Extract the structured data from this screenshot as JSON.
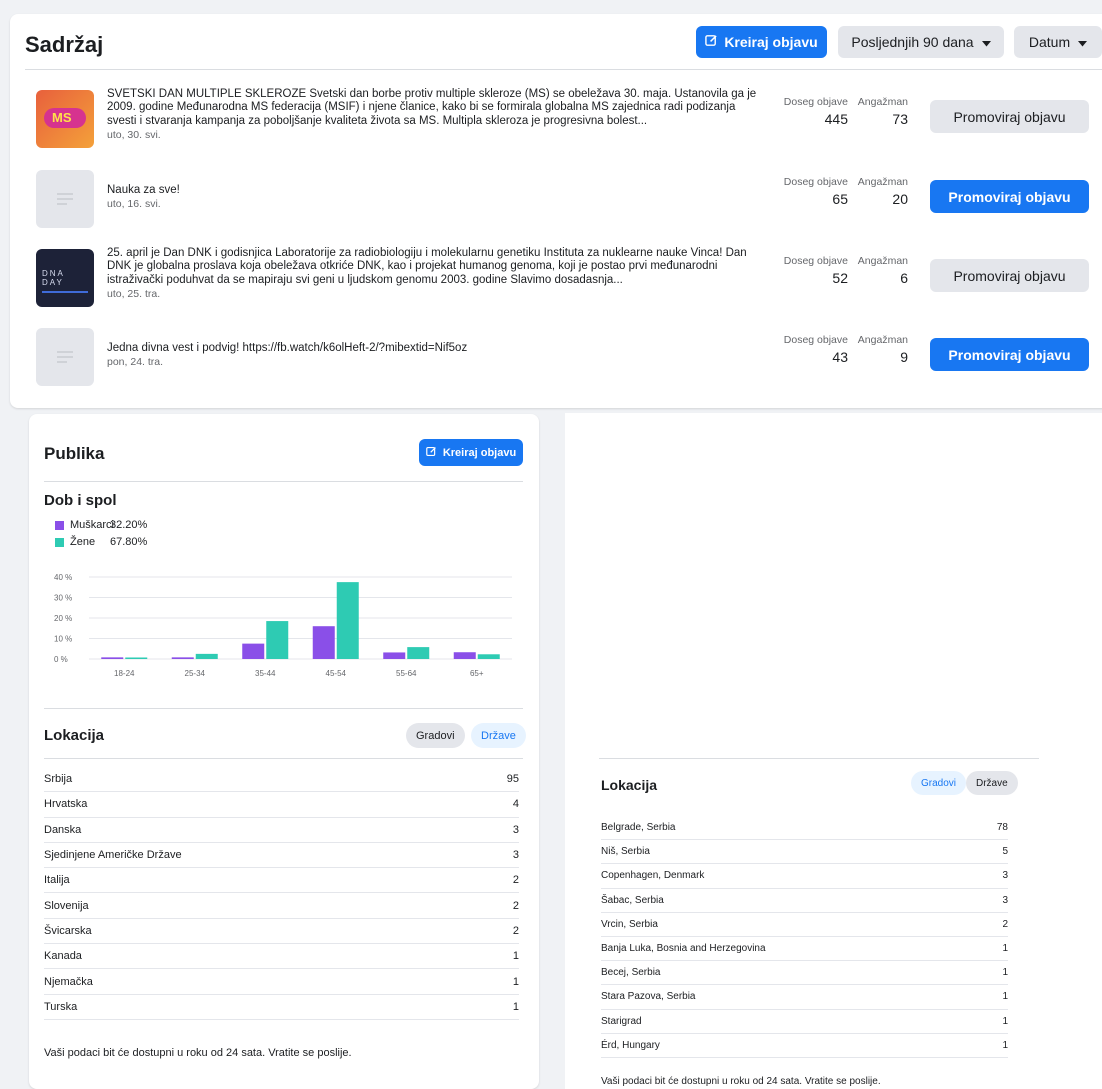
{
  "content": {
    "title": "Sadržaj",
    "create_post_label": "Kreiraj objavu",
    "range_label": "Posljednjih 90 dana",
    "sort_label": "Datum",
    "reach_label": "Doseg objave",
    "engagement_label": "Angažman",
    "promote_label": "Promoviraj objavu",
    "posts": [
      {
        "text": "SVETSKI DAN MULTIPLE SKLEROZE Svetski dan borbe protiv multiple skleroze (MS) se obeležava 30. maja. Ustanovila ga je 2009. godine Međunarodna MS federacija (MSIF) i njene članice, kako bi se formirala globalna MS zajednica radi podizanja svesti i stvaranja kampanja za poboljšanje kvaliteta života sa MS. Multipla skleroza je progresivna bolest...",
        "date": "uto, 30. svi.",
        "reach": "445",
        "engagement": "73",
        "thumb_label": "MS"
      },
      {
        "text": "Nauka za sve!",
        "date": "uto, 16. svi.",
        "reach": "65",
        "engagement": "20",
        "thumb_label": ""
      },
      {
        "text": "25. april je Dan DNK i godisnjica Laboratorije za radiobiologiju i molekularnu genetiku Instituta za nuklearne nauke Vinca! Dan DNK je globalna proslava koja obeležava otkriće DNK, kao i projekat humanog genoma, koji je postao prvi međunarodni istraživački poduhvat da se mapiraju svi geni u ljudskom genomu 2003. godine Slavimo dosadasnja...",
        "date": "uto, 25. tra.",
        "reach": "52",
        "engagement": "6",
        "thumb_label": "DNA DAY"
      },
      {
        "text": "Jedna divna vest i podvig! https://fb.watch/k6olHeft-2/?mibextid=Nif5oz",
        "date": "pon, 24. tra.",
        "reach": "43",
        "engagement": "9",
        "thumb_label": ""
      }
    ]
  },
  "audience": {
    "title": "Publika",
    "create_post_label": "Kreiraj objavu",
    "age_gender_title": "Dob i spol",
    "legend": [
      {
        "label": "Muškarci",
        "pct": "32.20%"
      },
      {
        "label": "Žene",
        "pct": "67.80%"
      }
    ],
    "location_title": "Lokacija",
    "toggle_cities": "Gradovi",
    "toggle_countries": "Države",
    "countries": [
      {
        "name": "Srbija",
        "count": "95"
      },
      {
        "name": "Hrvatska",
        "count": "4"
      },
      {
        "name": "Danska",
        "count": "3"
      },
      {
        "name": "Sjedinjene Američke Države",
        "count": "3"
      },
      {
        "name": "Italija",
        "count": "2"
      },
      {
        "name": "Slovenija",
        "count": "2"
      },
      {
        "name": "Švicarska",
        "count": "2"
      },
      {
        "name": "Kanada",
        "count": "1"
      },
      {
        "name": "Njemačka",
        "count": "1"
      },
      {
        "name": "Turska",
        "count": "1"
      }
    ],
    "footnote": "Vaši podaci bit će dostupni u roku od 24 sata. Vratite se poslije."
  },
  "location_cities": {
    "title": "Lokacija",
    "toggle_cities": "Gradovi",
    "toggle_countries": "Države",
    "cities": [
      {
        "name": "Belgrade, Serbia",
        "count": "78"
      },
      {
        "name": "Niš, Serbia",
        "count": "5"
      },
      {
        "name": "Copenhagen, Denmark",
        "count": "3"
      },
      {
        "name": "Šabac, Serbia",
        "count": "3"
      },
      {
        "name": "Vrcin, Serbia",
        "count": "2"
      },
      {
        "name": "Banja Luka, Bosnia and Herzegovina",
        "count": "1"
      },
      {
        "name": "Becej, Serbia",
        "count": "1"
      },
      {
        "name": "Stara Pazova, Serbia",
        "count": "1"
      },
      {
        "name": "Starigrad",
        "count": "1"
      },
      {
        "name": "Érd, Hungary",
        "count": "1"
      }
    ],
    "footnote": "Vaši podaci bit će dostupni u roku od 24 sata. Vratite se poslije."
  },
  "colors": {
    "men": "#8a4fe8",
    "women": "#2ecbb3",
    "brand": "#1877f2"
  },
  "chart_data": {
    "type": "bar",
    "categories": [
      "18-24",
      "25-34",
      "35-44",
      "45-54",
      "55-64",
      "65+"
    ],
    "series": [
      {
        "name": "Muškarci",
        "values": [
          0.8,
          0.8,
          7.5,
          16,
          3.2,
          3.3
        ]
      },
      {
        "name": "Žene",
        "values": [
          0.4,
          2.5,
          18.5,
          37.5,
          5.8,
          2.3
        ]
      }
    ],
    "yticks": [
      "40 %",
      "30 %",
      "20 %",
      "10 %",
      "0 %"
    ],
    "ylim": [
      0,
      40
    ],
    "grid": true
  }
}
